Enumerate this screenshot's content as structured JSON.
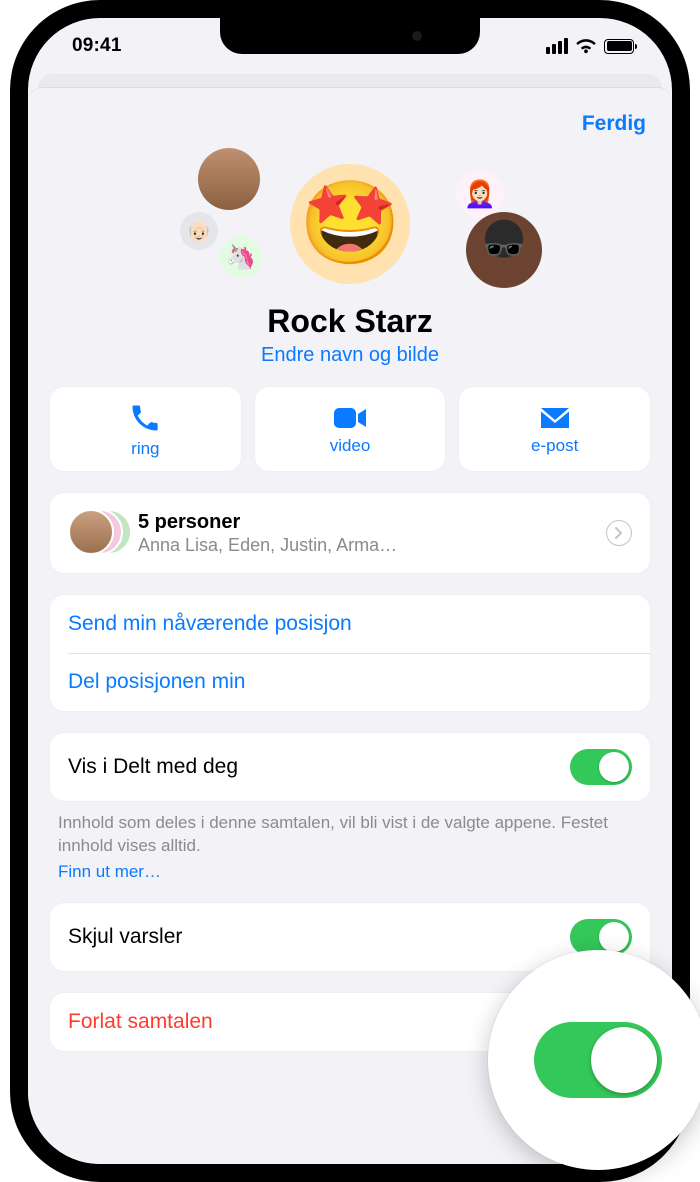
{
  "status": {
    "time": "09:41"
  },
  "sheet": {
    "done": "Ferdig",
    "group_name": "Rock Starz",
    "subtitle": "Endre navn og bilde"
  },
  "actions": {
    "call": "ring",
    "video": "video",
    "mail": "e-post"
  },
  "members": {
    "count_label": "5 personer",
    "names": "Anna Lisa, Eden, Justin, Arma…"
  },
  "location": {
    "send_current": "Send min nåværende posisjon",
    "share": "Del posisjonen min"
  },
  "shared": {
    "label": "Vis i Delt med deg",
    "note": "Innhold som deles i denne samtalen, vil bli vist i de valgte appene. Festet innhold vises alltid.",
    "learn_more": "Finn ut mer…"
  },
  "hide_alerts": {
    "label": "Skjul varsler"
  },
  "leave": {
    "label": "Forlat samtalen"
  }
}
